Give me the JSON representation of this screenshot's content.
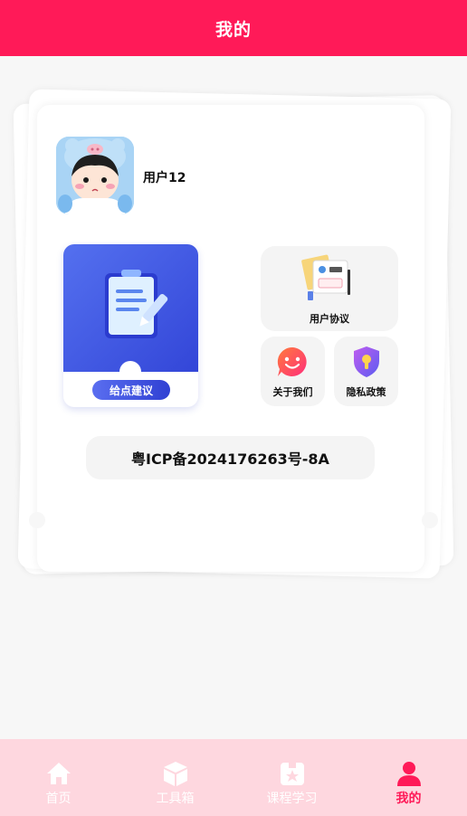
{
  "header": {
    "title": "我的"
  },
  "profile": {
    "username": "用户12",
    "avatar_icon": "avatar-cartoon-icon"
  },
  "feedback": {
    "button_label": "给点建议",
    "icon": "clipboard-pen-icon",
    "accent": "#3346d8"
  },
  "tiles": {
    "agreement": {
      "label": "用户协议",
      "icon": "documents-icon"
    },
    "about": {
      "label": "关于我们",
      "icon": "smiley-bubble-icon"
    },
    "privacy": {
      "label": "隐私政策",
      "icon": "shield-lock-icon"
    }
  },
  "icp": {
    "text": "粤ICP备2024176263号-8A"
  },
  "tabbar": {
    "items": [
      {
        "label": "首页",
        "icon": "home-icon"
      },
      {
        "label": "工具箱",
        "icon": "box-icon"
      },
      {
        "label": "课程学习",
        "icon": "book-star-icon"
      },
      {
        "label": "我的",
        "icon": "user-icon",
        "active": true
      }
    ]
  },
  "colors": {
    "primary": "#ff1a58",
    "tabbar_bg": "#fed7df",
    "page_bg": "#f7f7f7"
  }
}
